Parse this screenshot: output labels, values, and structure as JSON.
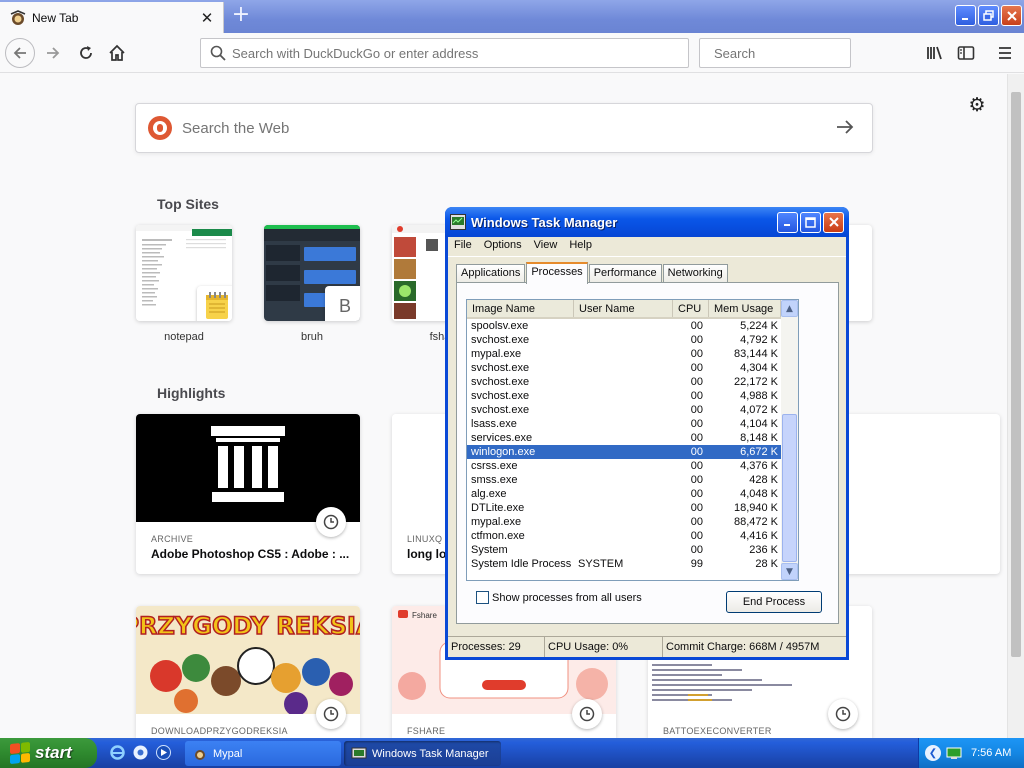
{
  "browser": {
    "tab_title": "New Tab",
    "tab_close": "✕",
    "new_tab": "+",
    "url_placeholder": "Search with DuckDuckGo or enter address",
    "search_placeholder": "Search"
  },
  "newtab": {
    "search_placeholder": "Search the Web",
    "top_sites_title": "Top Sites",
    "highlights_title": "Highlights",
    "top_sites": [
      {
        "label": "notepad"
      },
      {
        "label": "bruh",
        "badge": "B"
      },
      {
        "label": "fsha"
      }
    ],
    "highlights": [
      {
        "source": "ARCHIVE",
        "title": "Adobe Photoshop CS5 : Adobe : ..."
      },
      {
        "source": "LINUXQ",
        "title": "long lo"
      },
      {
        "source": "DOWNLOADPRZYGODREKSIA",
        "image_text": "PRZYGODY REKSIA"
      },
      {
        "source": "FSHARE",
        "image_text": "Fshare"
      },
      {
        "source": "BATTOEXECONVERTER"
      }
    ]
  },
  "taskmanager": {
    "title": "Windows Task Manager",
    "menu": [
      "File",
      "Options",
      "View",
      "Help"
    ],
    "tabs": [
      "Applications",
      "Processes",
      "Performance",
      "Networking"
    ],
    "active_tab": "Processes",
    "columns": [
      "Image Name",
      "User Name",
      "CPU",
      "Mem Usage"
    ],
    "processes": [
      {
        "name": "spoolsv.exe",
        "user": "",
        "cpu": "00",
        "mem": "5,224 K"
      },
      {
        "name": "svchost.exe",
        "user": "",
        "cpu": "00",
        "mem": "4,792 K"
      },
      {
        "name": "mypal.exe",
        "user": "",
        "cpu": "00",
        "mem": "83,144 K"
      },
      {
        "name": "svchost.exe",
        "user": "",
        "cpu": "00",
        "mem": "4,304 K"
      },
      {
        "name": "svchost.exe",
        "user": "",
        "cpu": "00",
        "mem": "22,172 K"
      },
      {
        "name": "svchost.exe",
        "user": "",
        "cpu": "00",
        "mem": "4,988 K"
      },
      {
        "name": "svchost.exe",
        "user": "",
        "cpu": "00",
        "mem": "4,072 K"
      },
      {
        "name": "lsass.exe",
        "user": "",
        "cpu": "00",
        "mem": "4,104 K"
      },
      {
        "name": "services.exe",
        "user": "",
        "cpu": "00",
        "mem": "8,148 K"
      },
      {
        "name": "winlogon.exe",
        "user": "",
        "cpu": "00",
        "mem": "6,672 K",
        "selected": true
      },
      {
        "name": "csrss.exe",
        "user": "",
        "cpu": "00",
        "mem": "4,376 K"
      },
      {
        "name": "smss.exe",
        "user": "",
        "cpu": "00",
        "mem": "428 K"
      },
      {
        "name": "alg.exe",
        "user": "",
        "cpu": "00",
        "mem": "4,048 K"
      },
      {
        "name": "DTLite.exe",
        "user": "",
        "cpu": "00",
        "mem": "18,940 K"
      },
      {
        "name": "mypal.exe",
        "user": "",
        "cpu": "00",
        "mem": "88,472 K"
      },
      {
        "name": "ctfmon.exe",
        "user": "",
        "cpu": "00",
        "mem": "4,416 K"
      },
      {
        "name": "System",
        "user": "",
        "cpu": "00",
        "mem": "236 K"
      },
      {
        "name": "System Idle Process",
        "user": "SYSTEM",
        "cpu": "99",
        "mem": "28 K"
      }
    ],
    "show_all_label": "Show processes from all users",
    "end_process_label": "End Process",
    "status": {
      "processes": "Processes: 29",
      "cpu": "CPU Usage: 0%",
      "commit": "Commit Charge: 668M / 4957M"
    }
  },
  "taskbar": {
    "start_label": "start",
    "tasks": [
      {
        "label": "Mypal"
      },
      {
        "label": "Windows Task Manager"
      }
    ],
    "clock": "7:56 AM"
  }
}
